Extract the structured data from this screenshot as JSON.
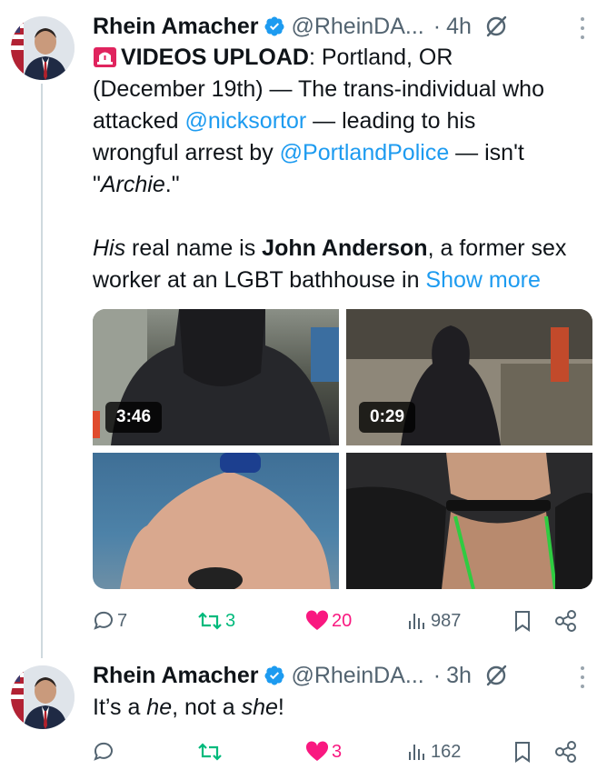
{
  "tweets": [
    {
      "author": {
        "display_name": "Rhein Amacher",
        "handle": "@RheinDA...",
        "verified": true
      },
      "time": "4h",
      "dot": "·",
      "text": {
        "alert_emoji": "siren",
        "headline": "VIDEOS UPLOAD",
        "line1_after_headline": ": Portland, OR",
        "line2": "(December 19th) — The trans-individual who",
        "line3_pre": "attacked ",
        "mention1": "@nicksortor",
        "line3_post": " — leading to his",
        "line4_pre": "wrongful arrest by ",
        "mention2": "@PortlandPolice",
        "line4_post": " — isn't",
        "line5_open_quote": "\"",
        "line5_italic": "Archie",
        "line5_close": ".\"",
        "p2_italic": "His",
        "p2_pre": " real name is ",
        "p2_bold": "John Anderson",
        "p2_post": ", a former sex",
        "p2_line2": "worker at an LGBT bathhouse in ",
        "show_more": "Show more"
      },
      "media": [
        {
          "type": "video",
          "duration": "3:46"
        },
        {
          "type": "video",
          "duration": "0:29"
        },
        {
          "type": "image"
        },
        {
          "type": "image"
        }
      ],
      "actions": {
        "replies": "7",
        "reposts": "3",
        "likes": "20",
        "views": "987"
      }
    },
    {
      "author": {
        "display_name": "Rhein Amacher",
        "handle": "@RheinDA...",
        "verified": true
      },
      "time": "3h",
      "dot": "·",
      "text": {
        "pre": "It’s a ",
        "italic1": "he",
        "mid": ", not a ",
        "italic2": "she",
        "post": "!"
      },
      "actions": {
        "replies": "",
        "reposts": "",
        "likes": "3",
        "views": "162"
      }
    }
  ],
  "colors": {
    "link": "#1d9bf0",
    "like": "#f91880",
    "repost": "#00ba7c",
    "secondary": "#536471",
    "verified": "#1d9bf0"
  },
  "icons": [
    "siren-emoji",
    "verified-badge-icon",
    "grok-icon",
    "more-icon",
    "reply-icon",
    "repost-icon",
    "like-icon",
    "views-icon",
    "bookmark-icon",
    "share-icon"
  ]
}
